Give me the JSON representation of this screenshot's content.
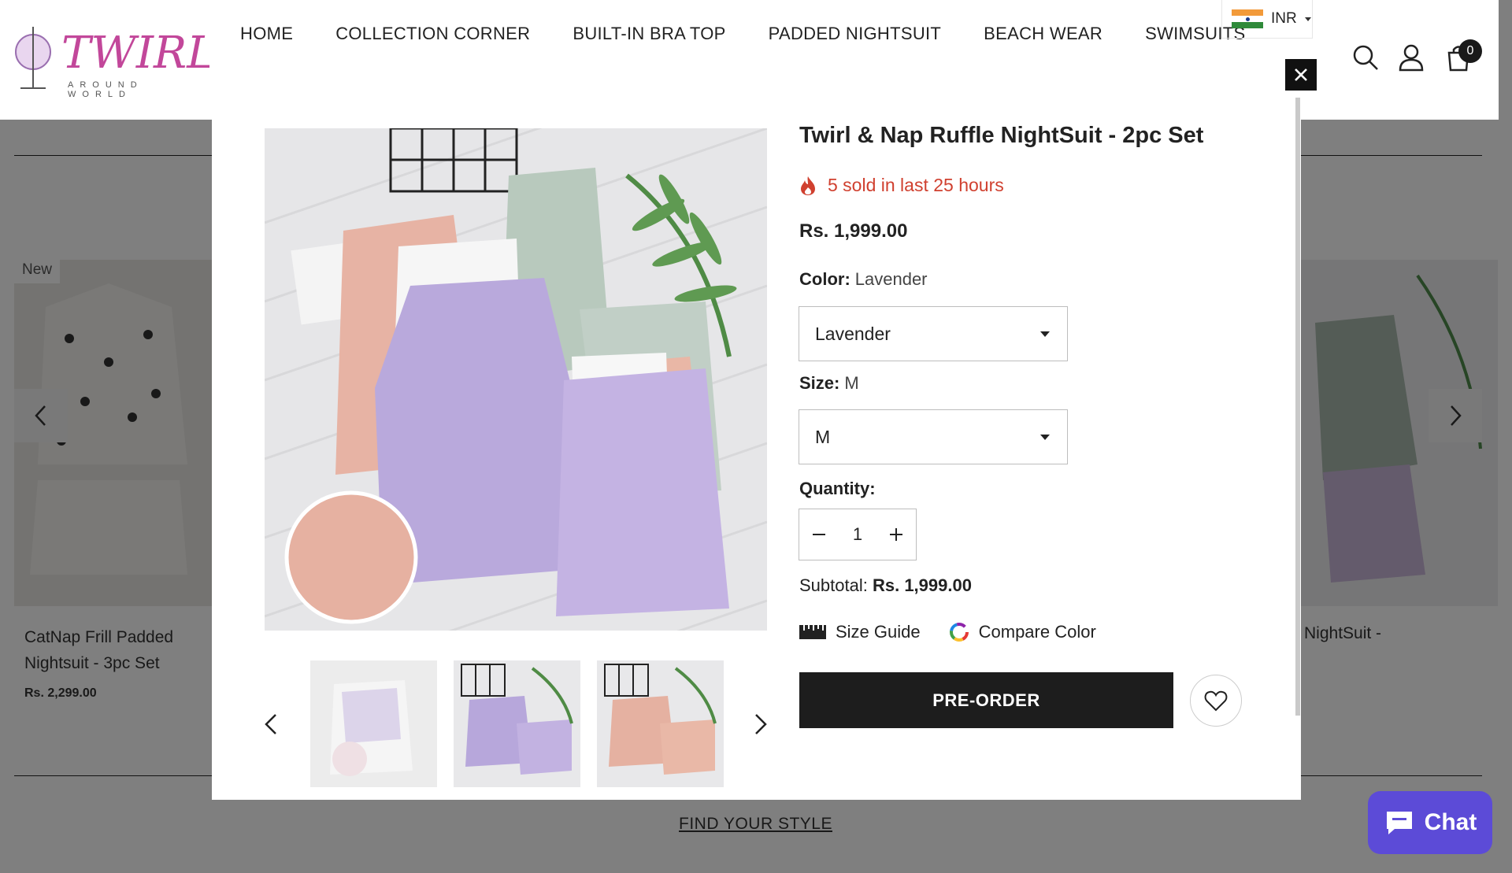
{
  "header": {
    "logo_text": "TWIRL",
    "logo_sub": "AROUND WORLD",
    "nav": [
      "HOME",
      "COLLECTION CORNER",
      "BUILT-IN BRA TOP",
      "PADDED NIGHTSUIT",
      "BEACH WEAR",
      "SWIMSUITS"
    ],
    "currency": "INR",
    "cart_count": "0"
  },
  "background": {
    "new_badge": "New",
    "left_product_title": "CatNap Frill Padded Nightsuit - 3pc Set",
    "left_product_price": "Rs. 2,299.00",
    "right_product_title": "NightSuit -",
    "find_style": "FIND YOUR STYLE"
  },
  "modal": {
    "title": "Twirl & Nap Ruffle NightSuit - 2pc Set",
    "sold_text": "5 sold in last 25 hours",
    "price": "Rs. 1,999.00",
    "color_label": "Color:",
    "color_value": "Lavender",
    "color_select": "Lavender",
    "size_label": "Size:",
    "size_value": "M",
    "size_select": "M",
    "quantity_label": "Quantity:",
    "quantity": "1",
    "subtotal_label": "Subtotal:",
    "subtotal_value": "Rs. 1,999.00",
    "size_guide": "Size Guide",
    "compare_color": "Compare Color",
    "preorder": "PRE-ORDER"
  },
  "chat": {
    "label": "Chat"
  },
  "colors": {
    "accent": "#5c4bd7",
    "sold_red": "#d0402f",
    "logo_pink": "#c2479a"
  }
}
